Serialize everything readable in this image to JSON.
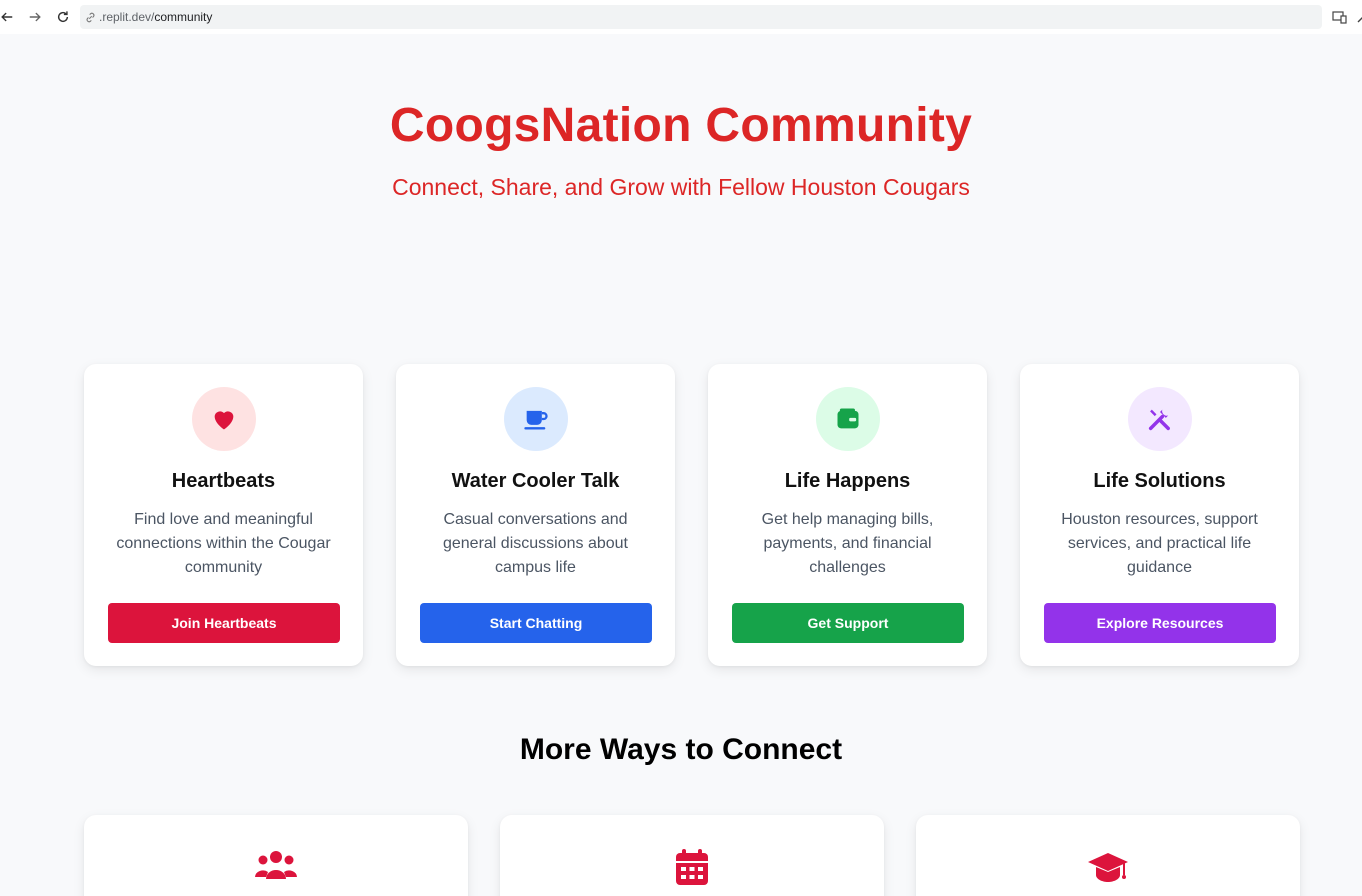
{
  "browser": {
    "url_host": ".replit.dev/",
    "url_path": "community"
  },
  "hero": {
    "title": "CoogsNation Community",
    "subtitle": "Connect, Share, and Grow with Fellow Houston Cougars"
  },
  "cards": [
    {
      "icon": "heart-icon",
      "title": "Heartbeats",
      "description": "Find love and meaningful connections within the Cougar community",
      "button": "Join Heartbeats",
      "accent": "#dc143c",
      "icon_bg": "#fee2e2"
    },
    {
      "icon": "coffee-icon",
      "title": "Water Cooler Talk",
      "description": "Casual conversations and general discussions about campus life",
      "button": "Start Chatting",
      "accent": "#2563eb",
      "icon_bg": "#dbeafe"
    },
    {
      "icon": "wallet-icon",
      "title": "Life Happens",
      "description": "Get help managing bills, payments, and financial challenges",
      "button": "Get Support",
      "accent": "#16a34a",
      "icon_bg": "#dcfce7"
    },
    {
      "icon": "tools-icon",
      "title": "Life Solutions",
      "description": "Houston resources, support services, and practical life guidance",
      "button": "Explore Resources",
      "accent": "#9333ea",
      "icon_bg": "#f3e8ff"
    }
  ],
  "more": {
    "title": "More Ways to Connect",
    "icons": [
      "users-icon",
      "calendar-icon",
      "graduation-cap-icon"
    ],
    "accent": "#dc143c"
  }
}
